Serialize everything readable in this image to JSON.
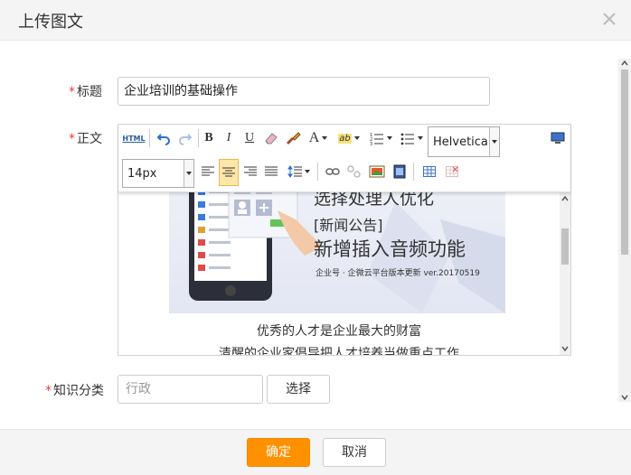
{
  "dialog": {
    "title": "上传图文"
  },
  "fields": {
    "title_label": "标题",
    "title_value": "企业培训的基础操作",
    "body_label": "正文",
    "category_label": "知识分类",
    "category_placeholder": "行政",
    "select_button": "选择"
  },
  "toolbar": {
    "html_label": "HTML",
    "font_family": "Helvetica N",
    "font_size": "14px"
  },
  "content": {
    "banner_line1": "选择处理人优化",
    "banner_line2": "[新闻公告]",
    "banner_line3": "新增插入音频功能",
    "banner_caption": "企业号 · 企微云平台版本更新  ver.20170519",
    "paragraph1": "优秀的人才是企业最大的财富",
    "paragraph2": "清醒的企业家倡导把人才培养当做重点工作"
  },
  "footer": {
    "confirm_label": "确定",
    "cancel_label": "取消"
  },
  "colors": {
    "accent": "#ff9100",
    "required": "#e4393c"
  }
}
